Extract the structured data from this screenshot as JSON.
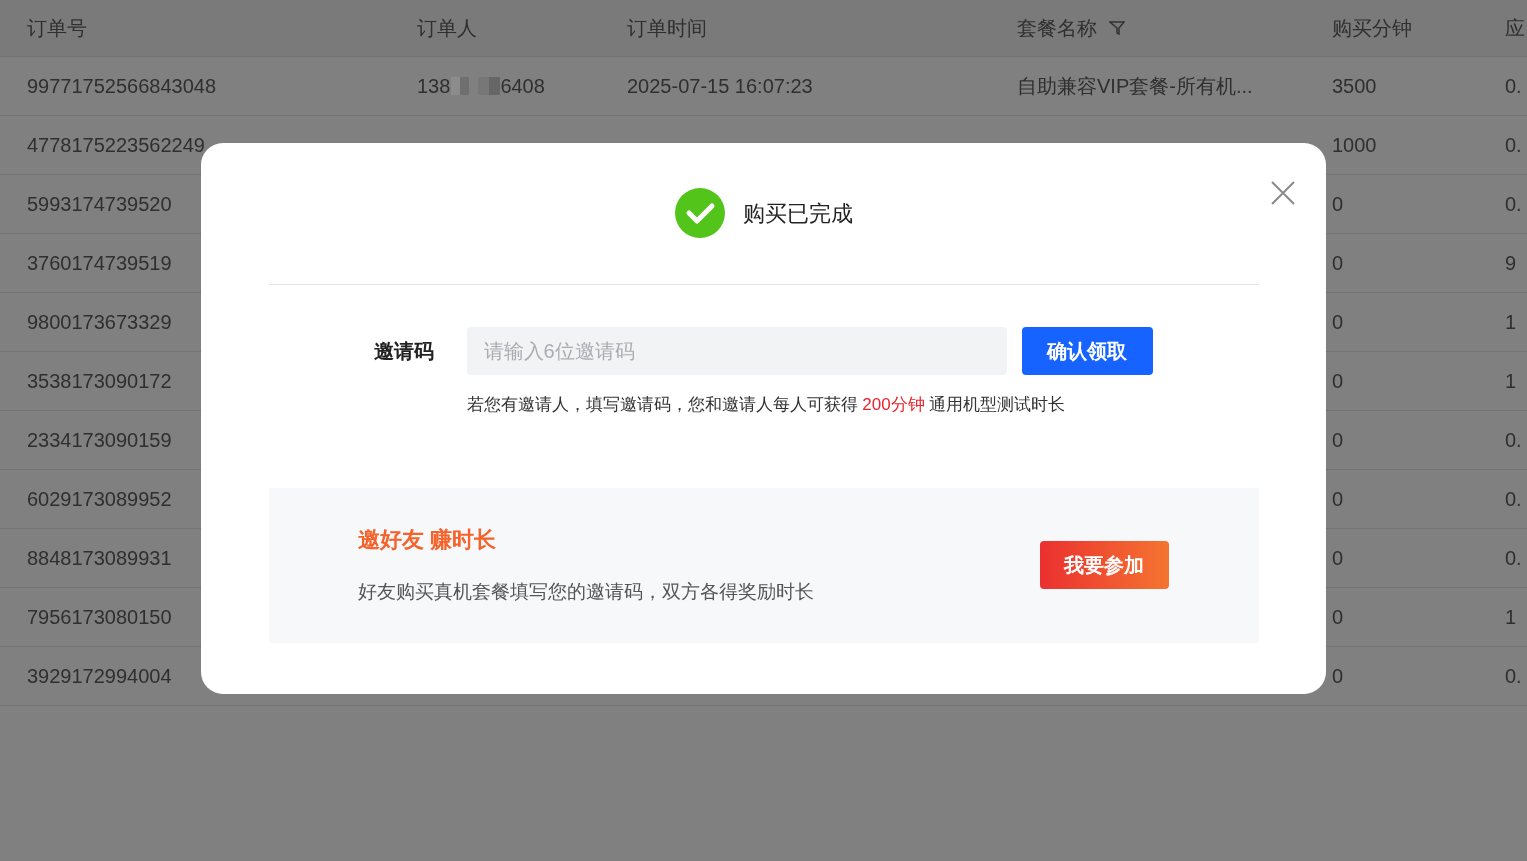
{
  "table": {
    "columns": [
      {
        "label": "订单号",
        "filter": false
      },
      {
        "label": "订单人",
        "filter": false
      },
      {
        "label": "订单时间",
        "filter": false
      },
      {
        "label": "套餐名称",
        "filter": true
      },
      {
        "label": "购买分钟",
        "filter": false
      },
      {
        "label": "应"
      }
    ],
    "rows": [
      {
        "cells": [
          "99771752566843048",
          {
            "prefix": "138",
            "suffix": "6408"
          },
          "2025-07-15 16:07:23",
          "自助兼容VIP套餐-所有机...",
          "3500",
          "0."
        ]
      },
      {
        "cells": [
          "4778175223562249",
          null,
          null,
          null,
          "1000",
          "0."
        ]
      },
      {
        "cells": [
          "5993174739520",
          null,
          null,
          null,
          "0",
          "0."
        ]
      },
      {
        "cells": [
          "3760174739519",
          null,
          null,
          null,
          "0",
          "9"
        ]
      },
      {
        "cells": [
          "9800173673329",
          null,
          null,
          null,
          "0",
          "1"
        ]
      },
      {
        "cells": [
          "3538173090172",
          null,
          null,
          null,
          "0",
          "1"
        ]
      },
      {
        "cells": [
          "2334173090159",
          null,
          null,
          null,
          "0",
          "0."
        ]
      },
      {
        "cells": [
          "6029173089952",
          null,
          null,
          null,
          "0",
          "0."
        ]
      },
      {
        "cells": [
          "8848173089931",
          null,
          null,
          null,
          "0",
          "0."
        ]
      },
      {
        "cells": [
          "7956173080150",
          null,
          null,
          null,
          "0",
          "1"
        ]
      },
      {
        "cells": [
          "3929172994004",
          null,
          null,
          null,
          "0",
          "0."
        ]
      }
    ]
  },
  "dialog": {
    "title": "购买已完成",
    "invite_label": "邀请码",
    "placeholder": "请输入6位邀请码",
    "confirm_button": "确认领取",
    "hint": [
      {
        "text": "若您有邀请人，填写邀请码，您和邀请人每人可获得 ",
        "highlight": false
      },
      {
        "text": "200分钟",
        "highlight": true
      },
      {
        "text": " 通用机型测试时长",
        "highlight": false
      }
    ],
    "promo": {
      "title": "邀好友 赚时长",
      "description": "好友购买真机套餐填写您的邀请码，双方各得奖励时长",
      "button": "我要参加"
    }
  }
}
